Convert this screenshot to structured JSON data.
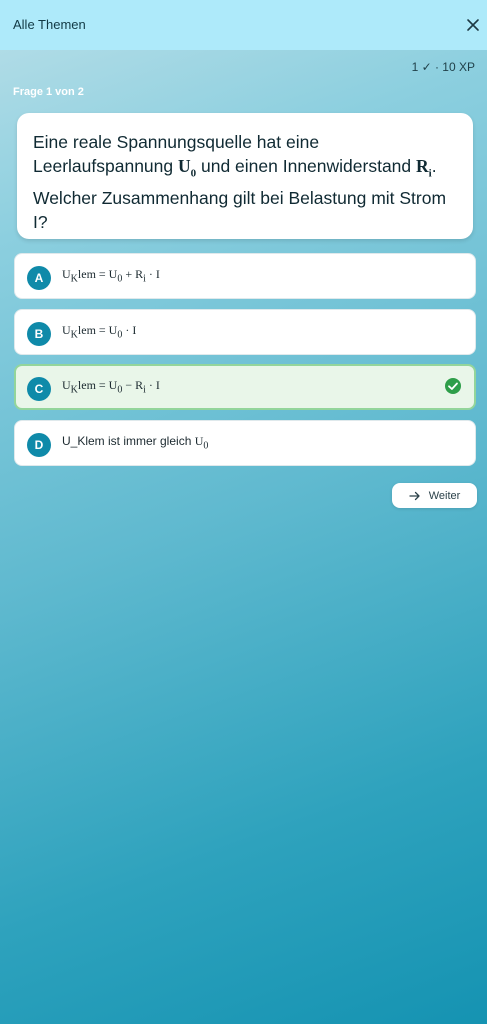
{
  "header": {
    "title": "Alle Themen",
    "close_icon": "close-icon"
  },
  "score": "1 ✓ · 10 XP",
  "progress": "Frage 1 von 2",
  "question": {
    "part1": "Eine reale Spannungsquelle hat eine Leerlaufspannung ",
    "symbol1": "U",
    "symbol1_sub": "0",
    "part2": " und einen Innenwiderstand ",
    "symbol2": "R",
    "symbol2_sub": "i",
    "part3": ". Welcher Zusammenhang gilt bei Belastung mit Strom I?"
  },
  "options": [
    {
      "letter": "A",
      "text": "U_Klem = U_0 + R_i · I",
      "display_main": "U",
      "display_sub": "K",
      "display_rest": "lem = U",
      "display_sub2": "0",
      "display_tail": " + R",
      "display_sub3": "i",
      "display_end": " · I"
    },
    {
      "letter": "B",
      "text": "U_Klem = U_0 · I",
      "display_main": "U",
      "display_sub": "K",
      "display_rest": "lem = U",
      "display_sub2": "0",
      "display_tail": " · I"
    },
    {
      "letter": "C",
      "text": "U_Klem = U_0 − R_i · I",
      "display_main": "U",
      "display_sub": "K",
      "display_rest": "lem = U",
      "display_sub2": "0",
      "display_tail": " − R",
      "display_sub3": "i",
      "display_end": " · I",
      "state": "correct"
    },
    {
      "letter": "D",
      "text_plain": "U_Klem ist immer gleich ",
      "text_symbol": "U",
      "text_symbol_sub": "0"
    }
  ],
  "next_button": {
    "label": "Weiter",
    "icon": "arrow-right-icon"
  },
  "colors": {
    "header_bg": "#aeeafa",
    "accent": "#0f8aa9",
    "correct_bg": "#e9f6e9",
    "correct_border": "#93d59b",
    "check": "#2e9e4a"
  }
}
